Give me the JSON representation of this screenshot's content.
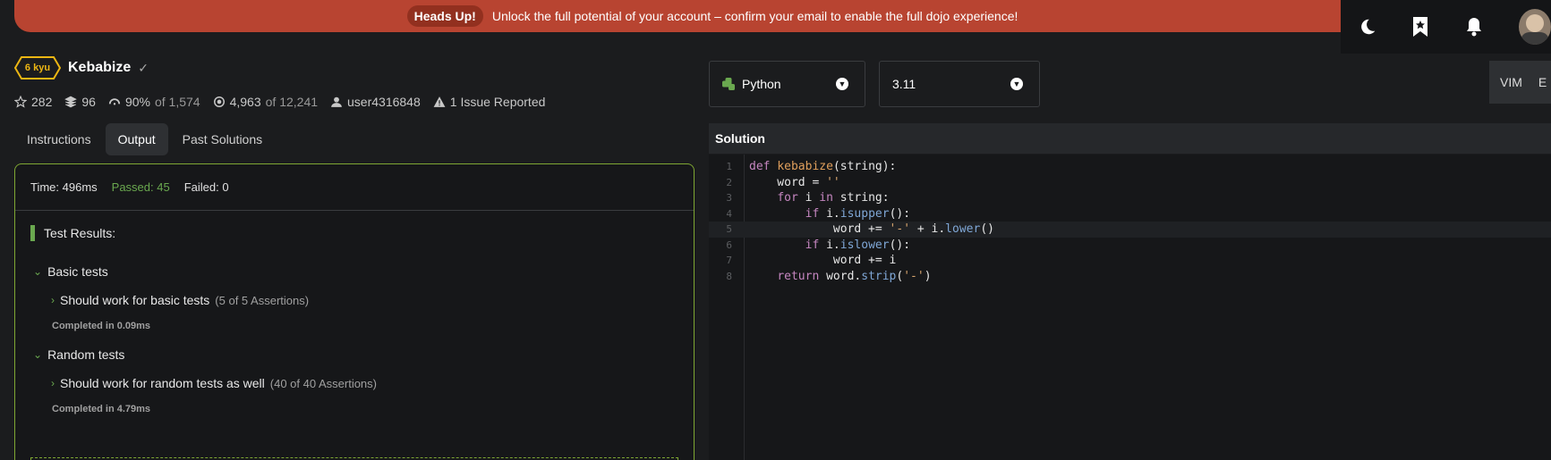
{
  "banner": {
    "pill": "Heads Up!",
    "message": "Unlock the full potential of your account – confirm your email to enable the full dojo experience!"
  },
  "topicons": [
    "moon-icon",
    "bookmark-star-icon",
    "bell-icon",
    "user-avatar"
  ],
  "kata": {
    "rank": "6 kyu",
    "name": "Kebabize",
    "rank_color": "#ecb613",
    "stats": {
      "stars": "282",
      "collections": "96",
      "satisfaction": "90%",
      "satisfaction_of": "of 1,574",
      "completed": "4,963",
      "completed_of": "of 12,241",
      "author": "user4316848",
      "issues": "1 Issue Reported"
    }
  },
  "tabs": [
    "Instructions",
    "Output",
    "Past Solutions"
  ],
  "output": {
    "time": "Time: 496ms",
    "passed": "Passed: 45",
    "failed": "Failed: 0",
    "results_title": "Test Results:",
    "groups": [
      {
        "title": "Basic tests",
        "it": "Should work for basic tests",
        "assertions": "(5 of 5 Assertions)",
        "completed": "Completed in 0.09ms"
      },
      {
        "title": "Random tests",
        "it": "Should work for random tests as well",
        "assertions": "(40 of 40 Assertions)",
        "completed": "Completed in 4.79ms"
      }
    ],
    "pass_color": "#6aa84f"
  },
  "language": {
    "selected": "Python",
    "version": "3.11"
  },
  "vim": {
    "label": "VIM",
    "extra": "E"
  },
  "solution": {
    "title": "Solution",
    "lines": [
      "1",
      "2",
      "3",
      "4",
      "5",
      "6",
      "7",
      "8"
    ]
  }
}
